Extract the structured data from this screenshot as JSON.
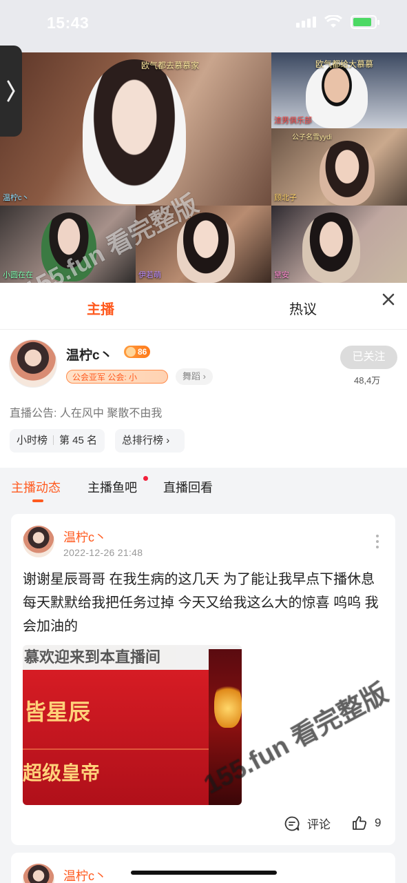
{
  "status_bar": {
    "time": "15:43"
  },
  "video": {
    "tiles": [
      {
        "caption": "欧气都去慕慕家",
        "name": "温柠c丶"
      },
      {
        "caption": "欧气都给大慕慕",
        "name": "渣男俱乐部"
      },
      {
        "caption": "公子名雪yydi",
        "name": "顾北子"
      },
      {
        "caption": "",
        "name": "小圆在在"
      },
      {
        "caption": "",
        "name": "伊若萌"
      },
      {
        "caption": "",
        "name": "黛安"
      }
    ],
    "watermark": "155.fun 看完整版"
  },
  "panel": {
    "tabs": [
      "主播",
      "热议"
    ],
    "host": {
      "name": "温柠c丶",
      "level": "86",
      "guild_badge": "公会亚军  公会: 小",
      "category_tag": "舞蹈",
      "follow_label": "已关注",
      "follower_count": "48,4万",
      "notice_label": "直播公告:",
      "notice_text": "人在风中 聚散不由我",
      "hour_rank_label": "小时榜",
      "hour_rank_value": "第 45 名",
      "total_rank_label": "总排行榜"
    },
    "sub_tabs": [
      "主播动态",
      "主播鱼吧",
      "直播回看"
    ]
  },
  "post": {
    "author": "温柠c丶",
    "date": "2022-12-26  21:48",
    "text": "谢谢星辰哥哥 在我生病的这几天 为了能让我早点下播休息 每天默默给我把任务过掉 今天又给我这么大的惊喜 呜呜 我会加油的",
    "image_text_top": "慕欢迎来到本直播间",
    "image_text_mid": "皆星辰",
    "image_text_bottom": "超级皇帝",
    "comment_label": "评论",
    "like_count": "9",
    "watermark": "155.fun 看完整版"
  },
  "post2": {
    "author": "温柠c丶"
  },
  "colors": {
    "accent": "#ff5a1f",
    "background": "#f3f4f6"
  }
}
